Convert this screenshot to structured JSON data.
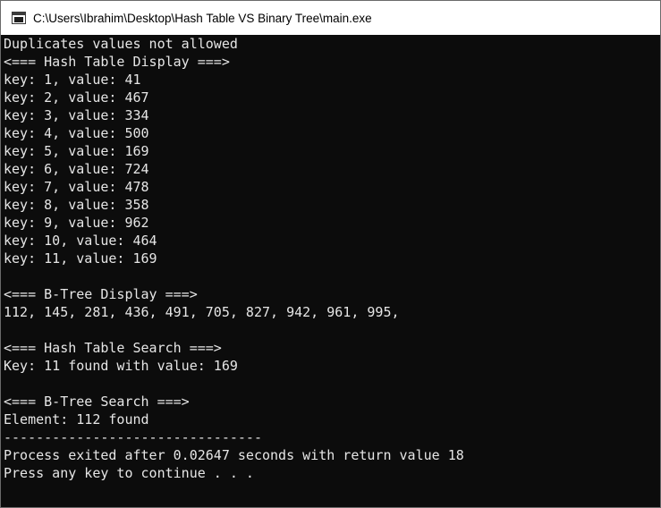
{
  "window": {
    "title": "C:\\Users\\Ibrahim\\Desktop\\Hash Table VS Binary Tree\\main.exe"
  },
  "console": {
    "lines": [
      "Duplicates values not allowed",
      "<=== Hash Table Display ===>",
      "key: 1, value: 41",
      "key: 2, value: 467",
      "key: 3, value: 334",
      "key: 4, value: 500",
      "key: 5, value: 169",
      "key: 6, value: 724",
      "key: 7, value: 478",
      "key: 8, value: 358",
      "key: 9, value: 962",
      "key: 10, value: 464",
      "key: 11, value: 169",
      "",
      "<=== B-Tree Display ===>",
      "112, 145, 281, 436, 491, 705, 827, 942, 961, 995,",
      "",
      "<=== Hash Table Search ===>",
      "Key: 11 found with value: 169",
      "",
      "<=== B-Tree Search ===>",
      "Element: 112 found",
      "--------------------------------",
      "Process exited after 0.02647 seconds with return value 18",
      "Press any key to continue . . ."
    ]
  }
}
